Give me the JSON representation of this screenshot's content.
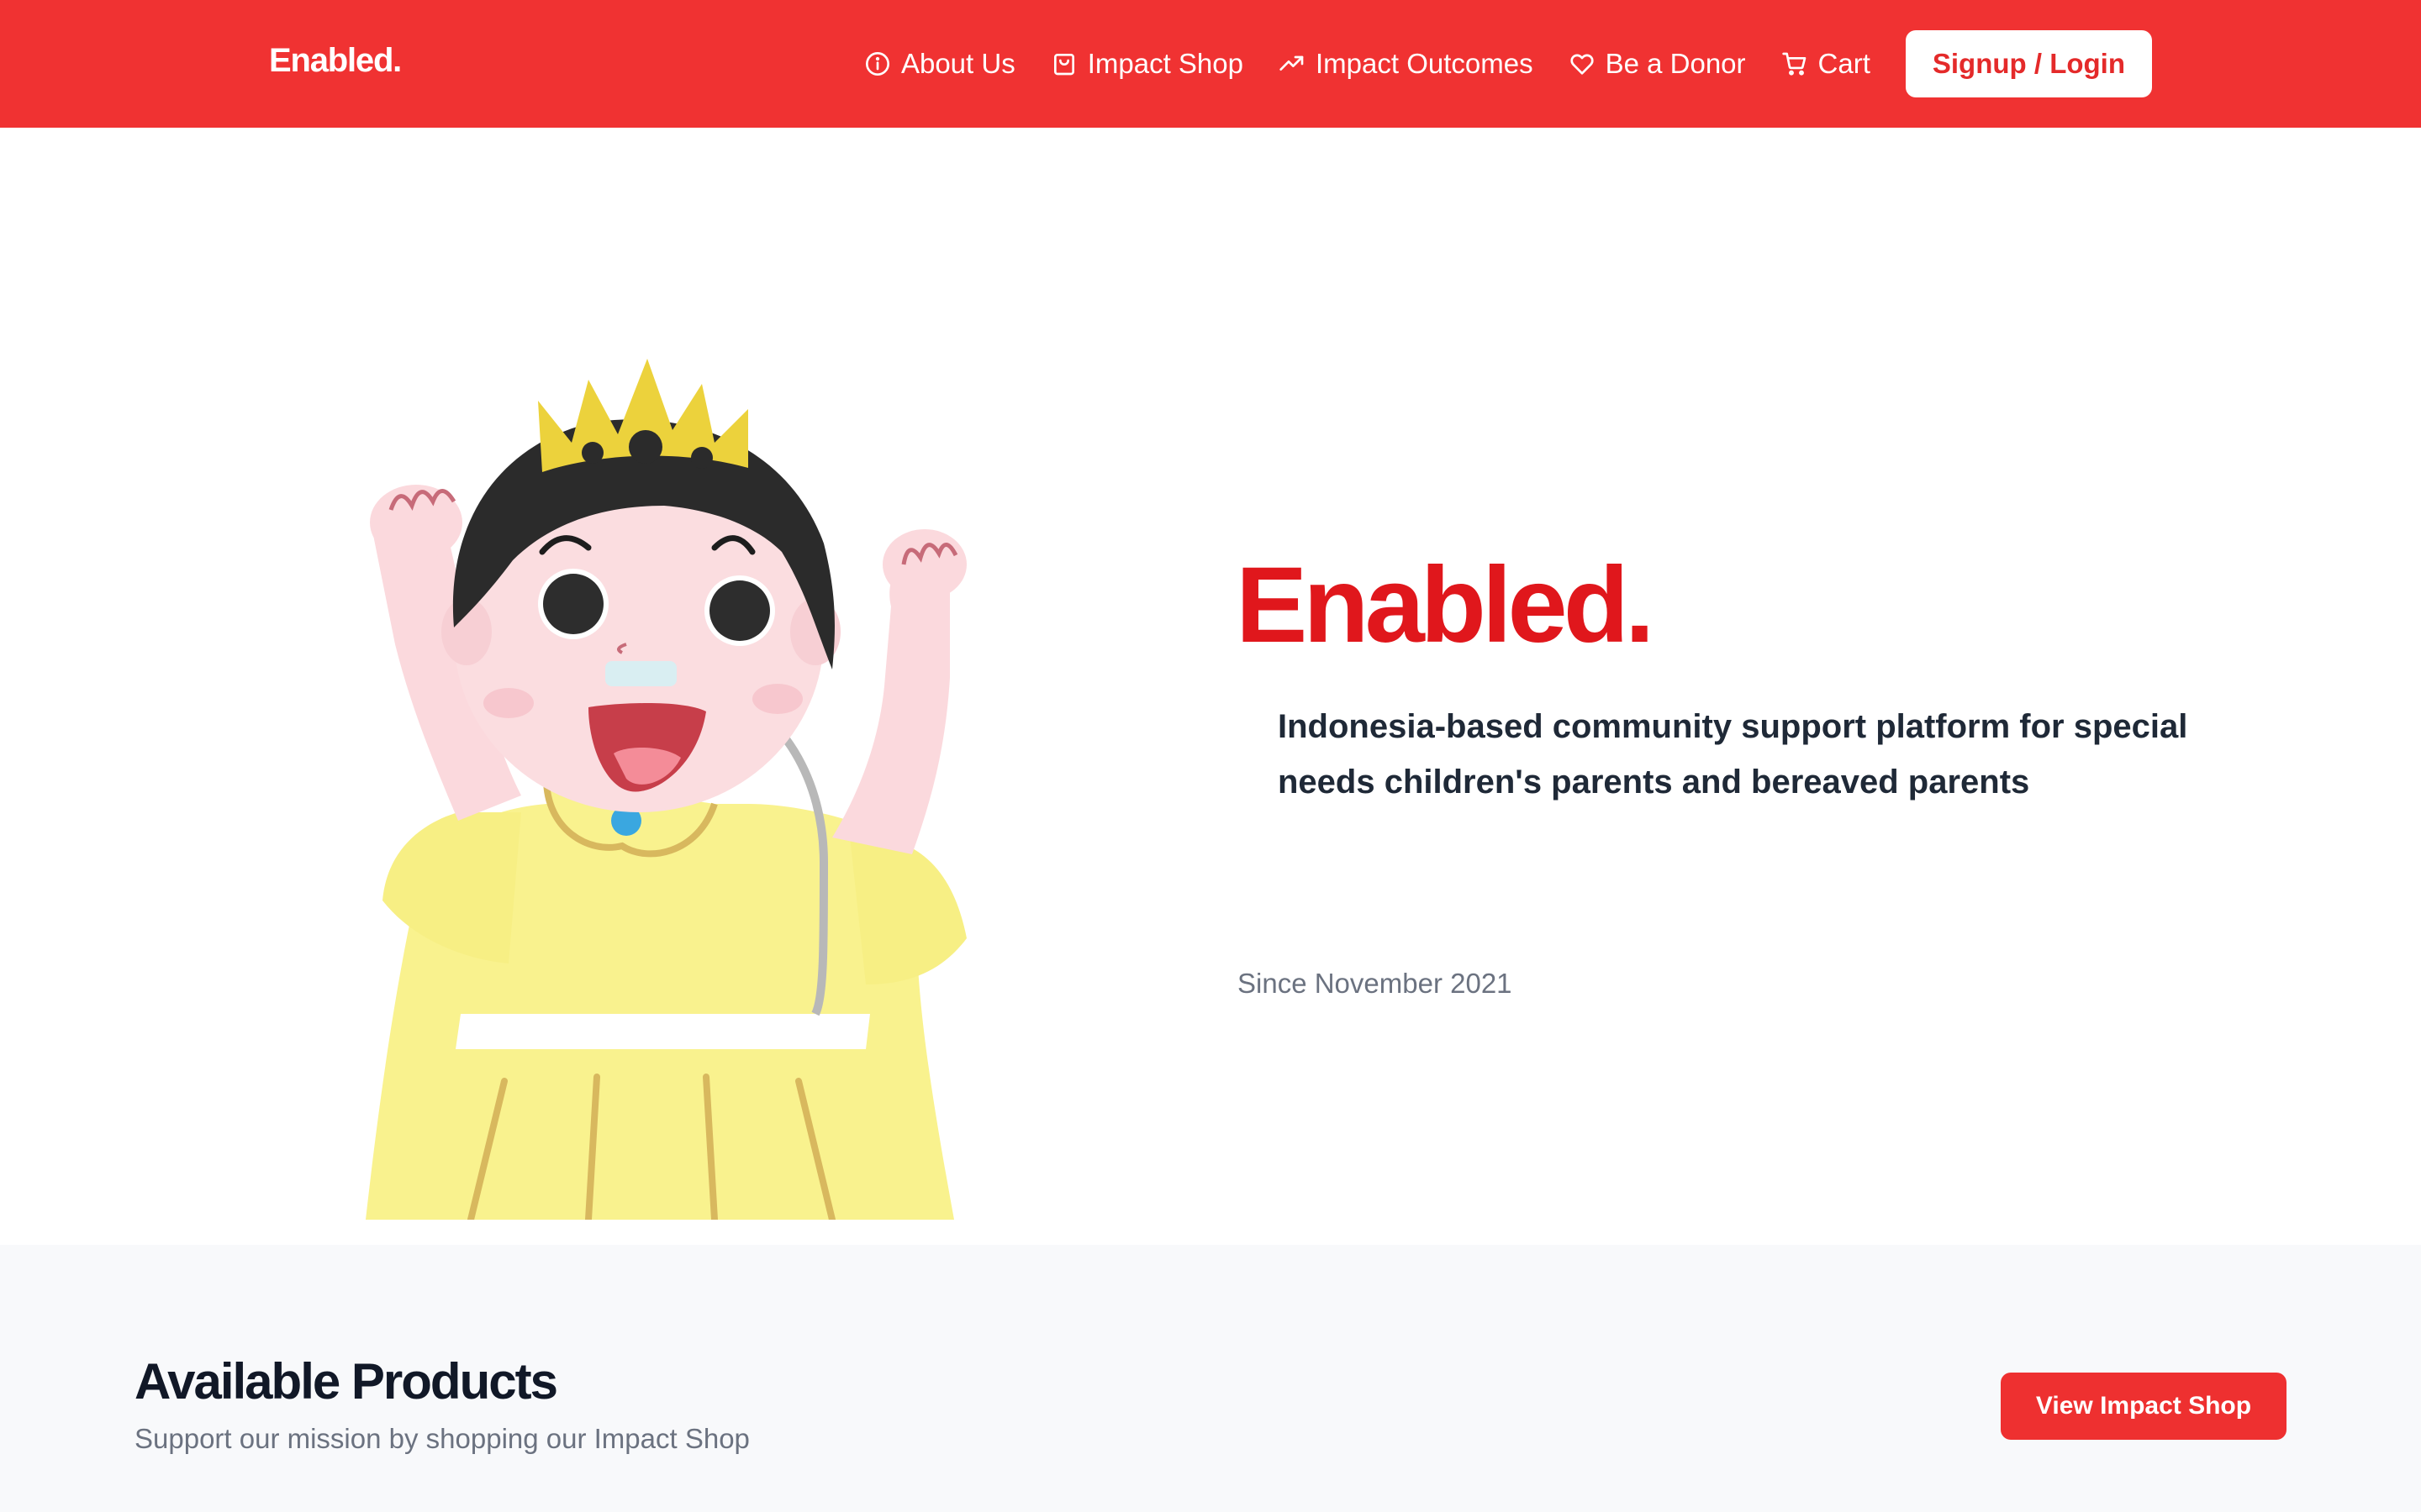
{
  "brand": {
    "name": "Enabled.",
    "accent": "#f03232"
  },
  "nav": {
    "items": [
      {
        "label": "About Us",
        "icon": "info-circle-icon"
      },
      {
        "label": "Impact Shop",
        "icon": "shopping-bag-icon"
      },
      {
        "label": "Impact Outcomes",
        "icon": "trending-up-icon"
      },
      {
        "label": "Be a Donor",
        "icon": "heart-icon"
      },
      {
        "label": "Cart",
        "icon": "cart-icon"
      }
    ],
    "cta": "Signup / Login"
  },
  "hero": {
    "title": "Enabled.",
    "description": "Indonesia-based community support platform for special needs children's parents and bereaved parents",
    "since": "Since November 2021",
    "illustration": "cartoon-child-with-crown-and-nasal-tube"
  },
  "products": {
    "title": "Available Products",
    "subtitle": "Support our mission by shopping our Impact Shop",
    "button": "View Impact Shop"
  }
}
